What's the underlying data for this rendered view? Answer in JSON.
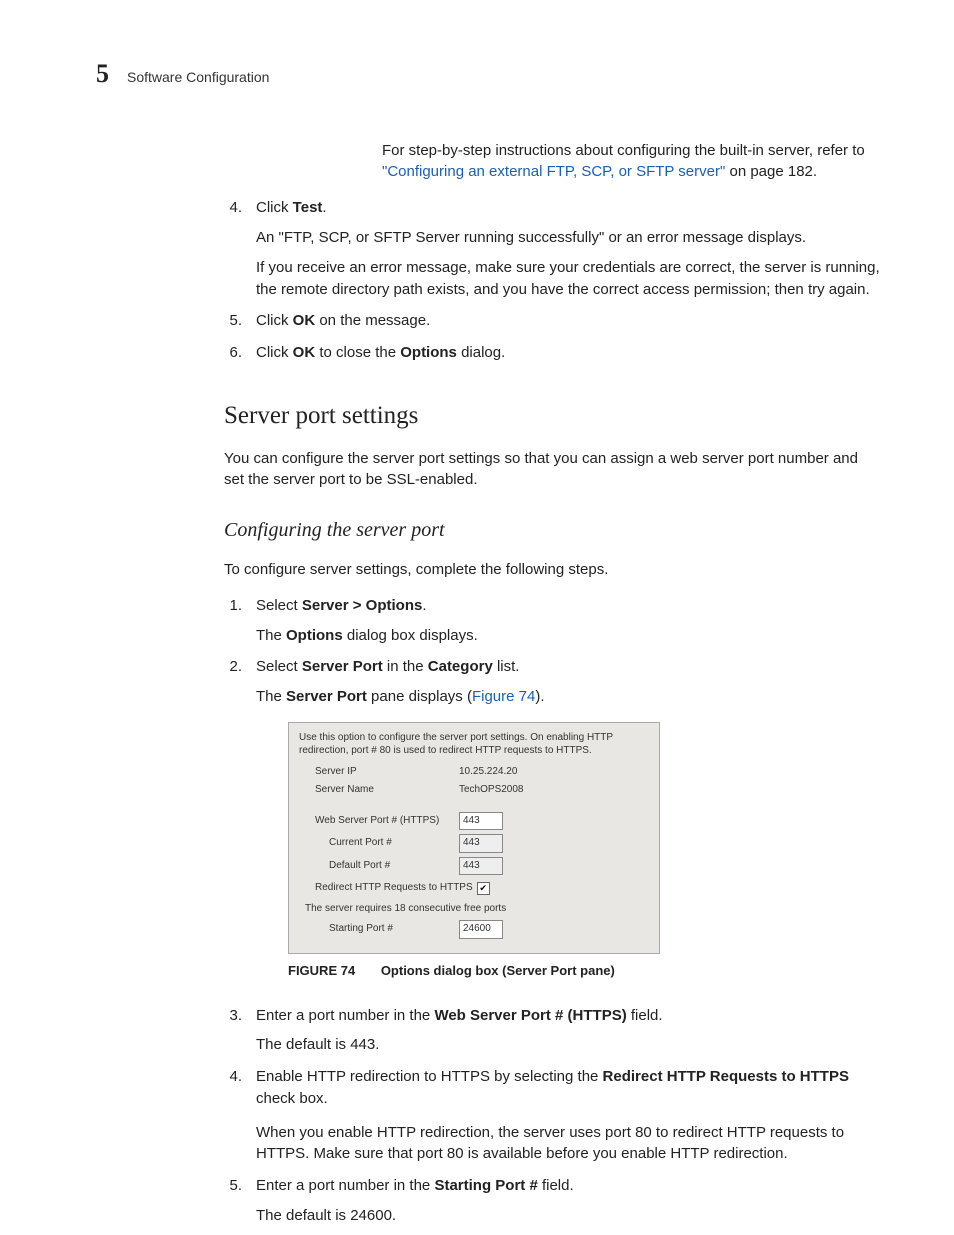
{
  "header": {
    "chapter_number": "5",
    "chapter_title": "Software Configuration"
  },
  "intro": {
    "lead": "For step-by-step instructions about configuring the built-in server, refer to ",
    "link": "\"Configuring an external FTP, SCP, or SFTP server\"",
    "tail": " on page 182."
  },
  "list1": {
    "i4": {
      "num": "4.",
      "l1a": "Click ",
      "l1b": "Test",
      "l1c": ".",
      "p2": "An \"FTP, SCP, or SFTP Server running successfully\" or an error message displays.",
      "p3": "If you receive an error message, make sure your credentials are correct, the server is running, the remote directory path exists, and you have the correct access permission; then try again."
    },
    "i5": {
      "num": "5.",
      "a": "Click ",
      "b": "OK",
      "c": " on the message."
    },
    "i6": {
      "num": "6.",
      "a": "Click ",
      "b": "OK",
      "c": " to close the ",
      "d": "Options",
      "e": " dialog."
    }
  },
  "h2": "Server port settings",
  "p_after_h2": "You can configure the server port settings so that you can assign a web server port number and set the server port to be SSL-enabled.",
  "h3": "Configuring the server port",
  "p_after_h3": "To configure server settings, complete the following steps.",
  "list2": {
    "i1": {
      "num": "1.",
      "a": "Select ",
      "b": "Server > Options",
      "c": ".",
      "p2a": "The ",
      "p2b": "Options",
      "p2c": " dialog box displays."
    },
    "i2": {
      "num": "2.",
      "a": "Select ",
      "b": "Server Port",
      "c": " in the ",
      "d": "Category",
      "e": " list.",
      "p2a": "The ",
      "p2b": "Server Port",
      "p2c": " pane displays (",
      "p2d": "Figure 74",
      "p2e": ")."
    },
    "i3": {
      "num": "3.",
      "a": "Enter a port number in the ",
      "b": "Web Server Port # (HTTPS)",
      "c": " field.",
      "p2": "The default is 443."
    },
    "i4": {
      "num": "4.",
      "a": "Enable HTTP redirection to HTTPS by selecting the ",
      "b": "Redirect HTTP Requests to HTTPS",
      "c": " check box.",
      "p2": "When you enable HTTP redirection, the server uses port 80 to redirect HTTP requests to HTTPS. Make sure that port 80 is available before you enable HTTP redirection."
    },
    "i5": {
      "num": "5.",
      "a": "Enter a port number in the ",
      "b": "Starting Port #",
      "c": " field.",
      "p2": "The default is 24600."
    }
  },
  "panel": {
    "hint": "Use this option to configure the server port settings. On enabling HTTP redirection, port # 80 is used to redirect HTTP requests to HTTPS.",
    "server_ip_label": "Server IP",
    "server_ip": "10.25.224.20",
    "server_name_label": "Server Name",
    "server_name": "TechOPS2008",
    "web_port_label": "Web Server Port # (HTTPS)",
    "web_port": "443",
    "current_port_label": "Current Port #",
    "current_port": "443",
    "default_port_label": "Default Port #",
    "default_port": "443",
    "redirect_label": "Redirect HTTP Requests to HTTPS",
    "redirect_check": "✔",
    "note": "The server requires 18 consecutive free ports",
    "starting_port_label": "Starting Port #",
    "starting_port": "24600"
  },
  "figcap": {
    "num": "FIGURE 74",
    "title": "Options dialog box (Server Port pane)"
  }
}
